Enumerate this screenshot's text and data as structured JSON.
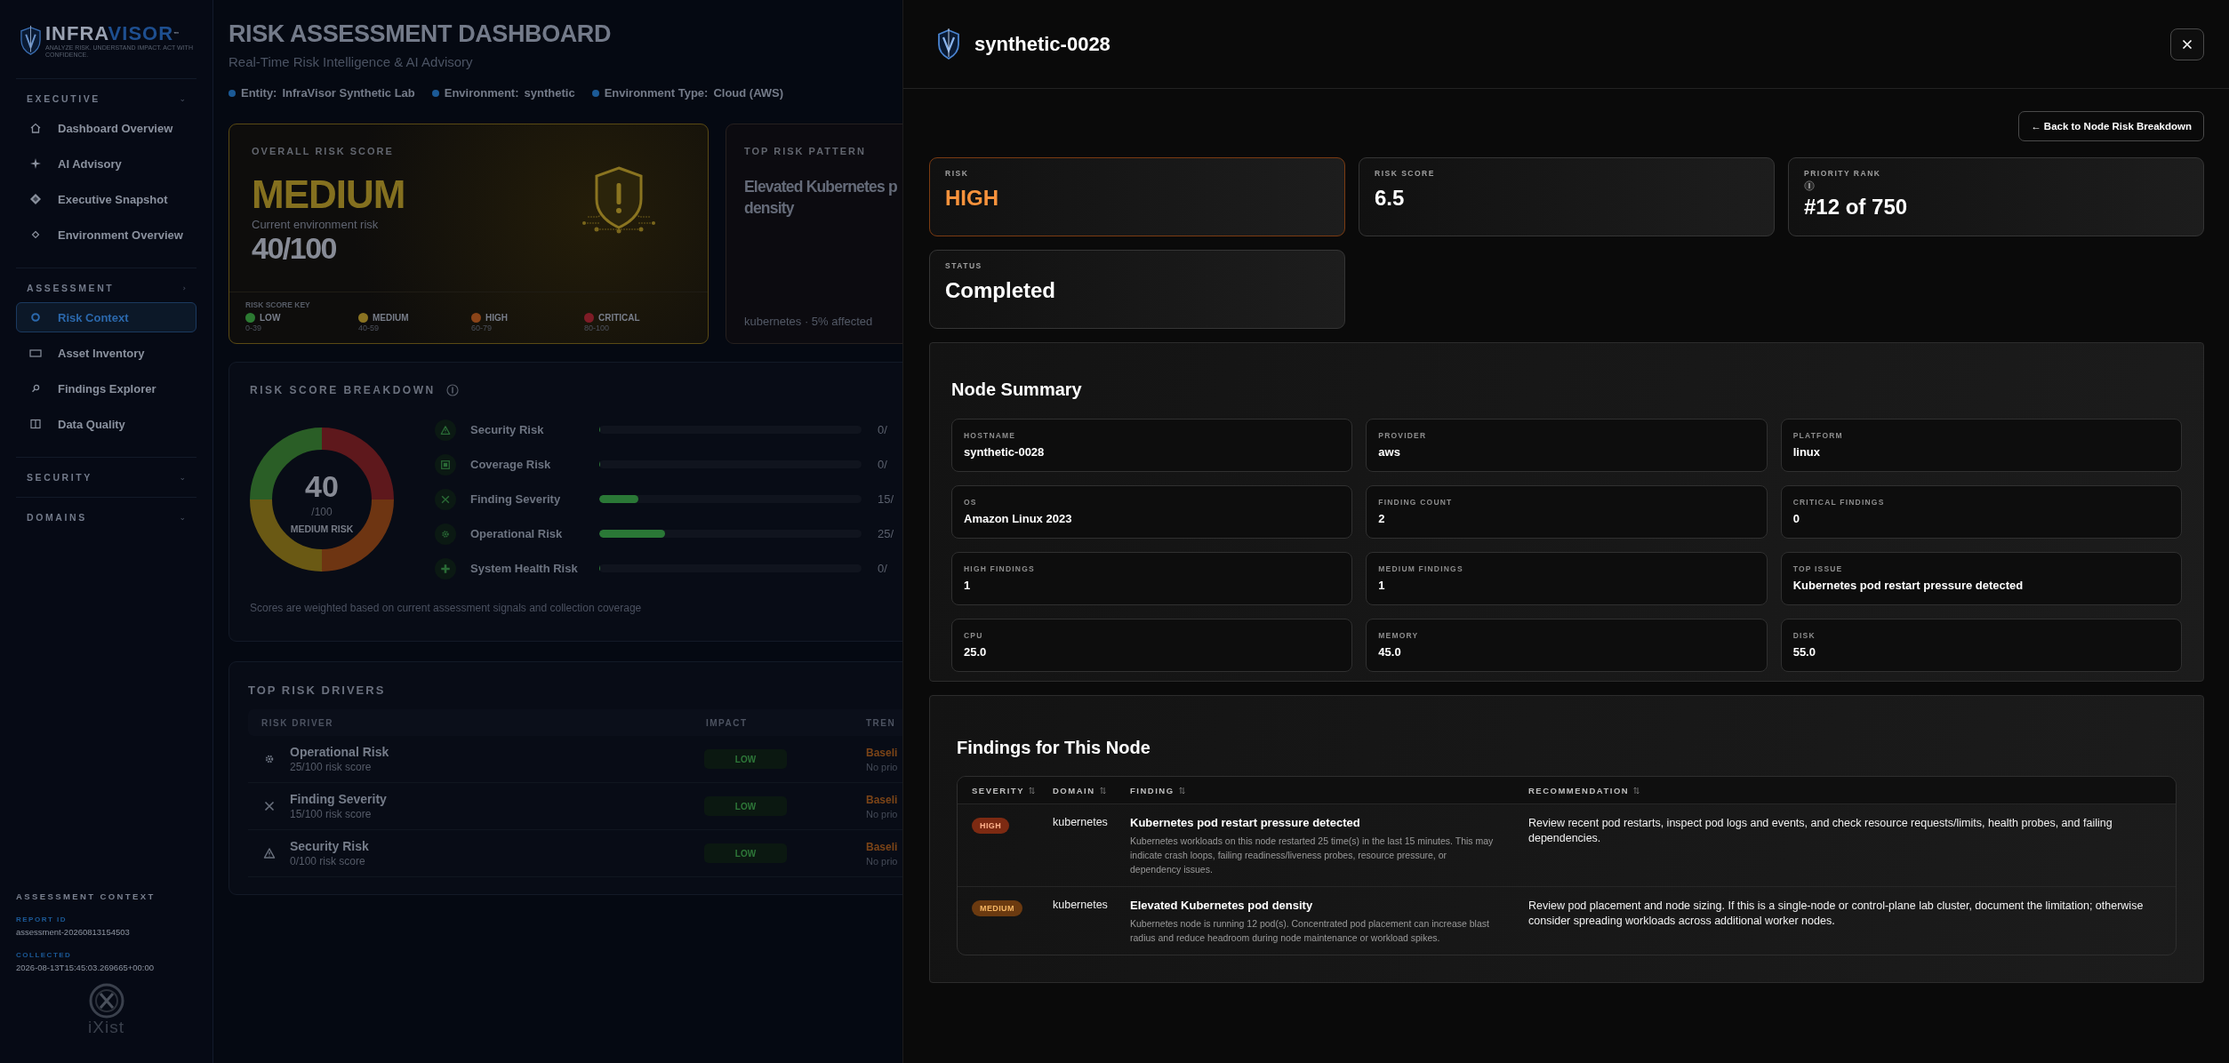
{
  "sidebar": {
    "brand": [
      "INFRA",
      "VISOR",
      "™"
    ],
    "tagline": "ANALYZE RISK. UNDERSTAND IMPACT. ACT WITH CONFIDENCE.",
    "sections": [
      {
        "title": "EXECUTIVE",
        "chevron": "⌄",
        "items": [
          {
            "label": "Dashboard Overview",
            "kind": "home",
            "selected": false
          },
          {
            "label": "AI Advisory",
            "kind": "sparkle",
            "selected": false
          },
          {
            "label": "Executive Snapshot",
            "kind": "diamond",
            "selected": false
          },
          {
            "label": "Environment Overview",
            "kind": "diamond-outline",
            "selected": false
          }
        ]
      },
      {
        "title": "ASSESSMENT",
        "chevron": "›",
        "items": [
          {
            "label": "Risk Context",
            "kind": "ring",
            "selected": true
          },
          {
            "label": "Asset Inventory",
            "kind": "rectangle",
            "selected": false
          },
          {
            "label": "Findings Explorer",
            "kind": "magnifier",
            "selected": false
          },
          {
            "label": "Data Quality",
            "kind": "columns",
            "selected": false
          }
        ]
      },
      {
        "title": "SECURITY",
        "chevron": "⌄"
      },
      {
        "title": "DOMAINS",
        "chevron": "⌄"
      }
    ],
    "context": {
      "title": "ASSESSMENT CONTEXT",
      "fields": [
        {
          "label": "REPORT ID",
          "value": "assessment-20260813154503"
        },
        {
          "label": "COLLECTED",
          "value": "2026-08-13T15:45:03.269665+00:00"
        }
      ]
    },
    "footer_brand": "iXist"
  },
  "main": {
    "title": "RISK ASSESSMENT DASHBOARD",
    "subtitle": "Real-Time Risk Intelligence & AI Advisory",
    "meta": [
      {
        "label": "Entity:",
        "value": "InfraVisor Synthetic Lab"
      },
      {
        "label": "Environment:",
        "value": "synthetic"
      },
      {
        "label": "Environment Type:",
        "value": "Cloud (AWS)"
      }
    ],
    "overall_card": {
      "label": "OVERALL RISK SCORE",
      "level_text": "MEDIUM",
      "caption": "Current environment risk",
      "score": "40/100",
      "key_title": "RISK SCORE KEY",
      "key": [
        {
          "label": "LOW",
          "range": "0-39",
          "color": "#2c7a32"
        },
        {
          "label": "MEDIUM",
          "range": "40-59",
          "color": "#8a7322"
        },
        {
          "label": "HIGH",
          "range": "60-79",
          "color": "#8a4418"
        },
        {
          "label": "CRITICAL",
          "range": "80-100",
          "color": "#7e1c26"
        }
      ]
    },
    "pattern_card": {
      "label": "TOP RISK PATTERN",
      "title_lines": [
        "Elevated Kubernetes p",
        "density"
      ],
      "footer": "kubernetes · 5% affected"
    },
    "breakdown": {
      "title": "RISK SCORE BREAKDOWN",
      "gauge": {
        "value": "40",
        "unit": "/100",
        "caption": "MEDIUM RISK"
      },
      "rows": [
        {
          "kind": "warning",
          "name": "Security Risk",
          "level": 0,
          "reading": "0/"
        },
        {
          "kind": "square",
          "name": "Coverage Risk",
          "level": 0,
          "reading": "0/"
        },
        {
          "kind": "x",
          "name": "Finding Severity",
          "level": 0.15,
          "reading": "15/"
        },
        {
          "kind": "gear",
          "name": "Operational Risk",
          "level": 0.25,
          "reading": "25/"
        },
        {
          "kind": "plus",
          "name": "System Health Risk",
          "level": 0,
          "reading": "0/"
        }
      ],
      "note": "Scores are weighted based on current assessment signals and collection coverage"
    },
    "drivers": {
      "title": "TOP RISK DRIVERS",
      "columns": [
        "RISK DRIVER",
        "IMPACT",
        "TREN"
      ],
      "rows": [
        {
          "kind": "gear",
          "name": "Operational Risk",
          "score": "25/100 risk score",
          "impact": "LOW",
          "trend": "Baseli",
          "trend_note": "No prio"
        },
        {
          "kind": "x",
          "name": "Finding Severity",
          "score": "15/100 risk score",
          "impact": "LOW",
          "trend": "Baseli",
          "trend_note": "No prio"
        },
        {
          "kind": "warning",
          "name": "Security Risk",
          "score": "0/100 risk score",
          "impact": "LOW",
          "trend": "Baseli",
          "trend_note": "No prio"
        }
      ]
    }
  },
  "panel": {
    "title": "synthetic-0028",
    "back_button": "← Back to Node Risk Breakdown",
    "stats": [
      {
        "kind": "risk",
        "label": "RISK",
        "value": "HIGH",
        "info": false
      },
      {
        "kind": "plain",
        "label": "RISK SCORE",
        "value": "6.5",
        "info": false
      },
      {
        "kind": "plain",
        "label": "PRIORITY RANK",
        "value": "#12 of 750",
        "info": true
      },
      {
        "kind": "plain",
        "label": "STATUS",
        "value": "Completed",
        "info": false
      }
    ],
    "summary": {
      "title": "Node Summary",
      "fields": [
        {
          "label": "HOSTNAME",
          "value": "synthetic-0028"
        },
        {
          "label": "PROVIDER",
          "value": "aws"
        },
        {
          "label": "PLATFORM",
          "value": "linux"
        },
        {
          "label": "OS",
          "value": "Amazon Linux 2023"
        },
        {
          "label": "FINDING COUNT",
          "value": "2"
        },
        {
          "label": "CRITICAL FINDINGS",
          "value": "0"
        },
        {
          "label": "HIGH FINDINGS",
          "value": "1"
        },
        {
          "label": "MEDIUM FINDINGS",
          "value": "1"
        },
        {
          "label": "TOP ISSUE",
          "value": "Kubernetes pod restart pressure detected"
        },
        {
          "label": "CPU",
          "value": "25.0"
        },
        {
          "label": "MEMORY",
          "value": "45.0"
        },
        {
          "label": "DISK",
          "value": "55.0"
        }
      ]
    },
    "findings": {
      "title": "Findings for This Node",
      "columns": [
        "SEVERITY",
        "DOMAIN",
        "FINDING",
        "RECOMMENDATION"
      ],
      "rows": [
        {
          "kind": "high",
          "severity": "HIGH",
          "domain": "kubernetes",
          "finding": "Kubernetes pod restart pressure detected",
          "detail": "Kubernetes workloads on this node restarted 25 time(s) in the last 15 minutes. This may indicate crash loops, failing readiness/liveness probes, resource pressure, or dependency issues.",
          "recommendation": "Review recent pod restarts, inspect pod logs and events, and check resource requests/limits, health probes, and failing dependencies."
        },
        {
          "kind": "medium",
          "severity": "MEDIUM",
          "domain": "kubernetes",
          "finding": "Elevated Kubernetes pod density",
          "detail": "Kubernetes node is running 12 pod(s). Concentrated pod placement can increase blast radius and reduce headroom during node maintenance or workload spikes.",
          "recommendation": "Review pod placement and node sizing. If this is a single-node or control-plane lab cluster, document the limitation; otherwise consider spreading workloads across additional worker nodes."
        }
      ]
    }
  }
}
